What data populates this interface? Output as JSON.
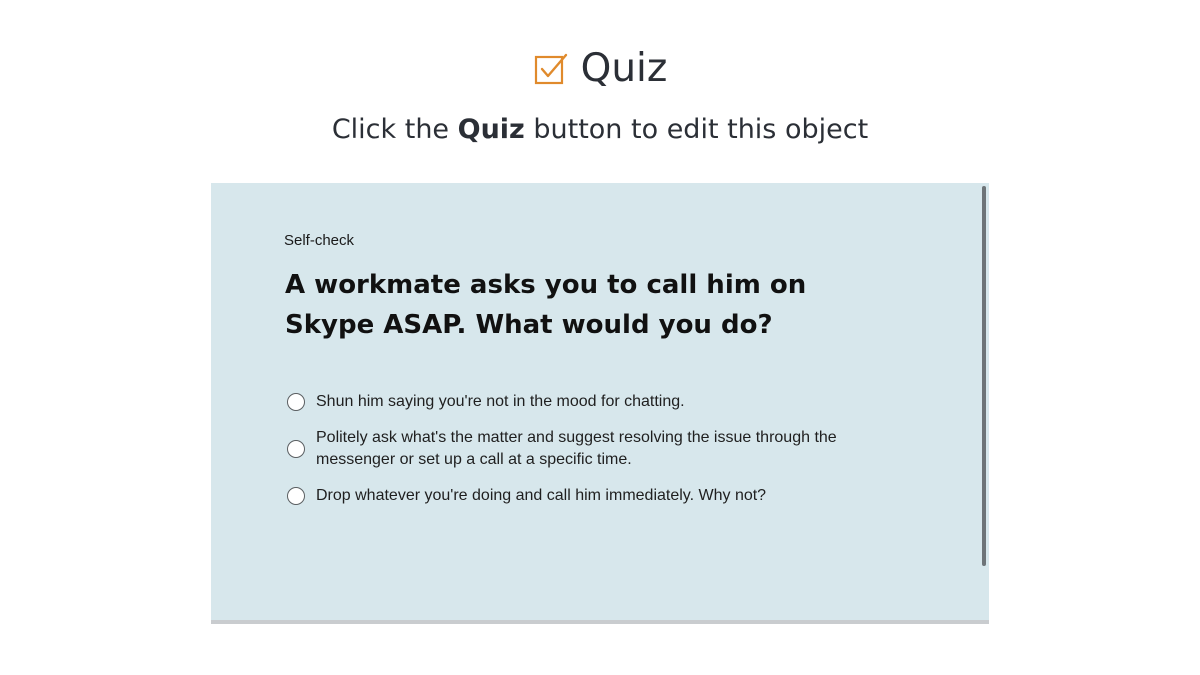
{
  "header": {
    "icon": "checkbox-checked-icon",
    "title": "Quiz",
    "accent_color": "#e08a2c"
  },
  "instruction": {
    "prefix": "Click the ",
    "bold": "Quiz",
    "suffix": " button to edit this object"
  },
  "quiz": {
    "label": "Self-check",
    "question": "A workmate asks you to call him on Skype ASAP. What would you do?",
    "options": [
      {
        "text": "Shun him saying you're not in the mood for chatting.",
        "selected": false
      },
      {
        "text": "Politely ask what's the matter and suggest resolving the issue through the messenger or set up a call at a specific time.",
        "selected": false
      },
      {
        "text": "Drop whatever you're doing and call him immediately. Why not?",
        "selected": false
      }
    ],
    "panel_color": "#d7e7ec"
  }
}
